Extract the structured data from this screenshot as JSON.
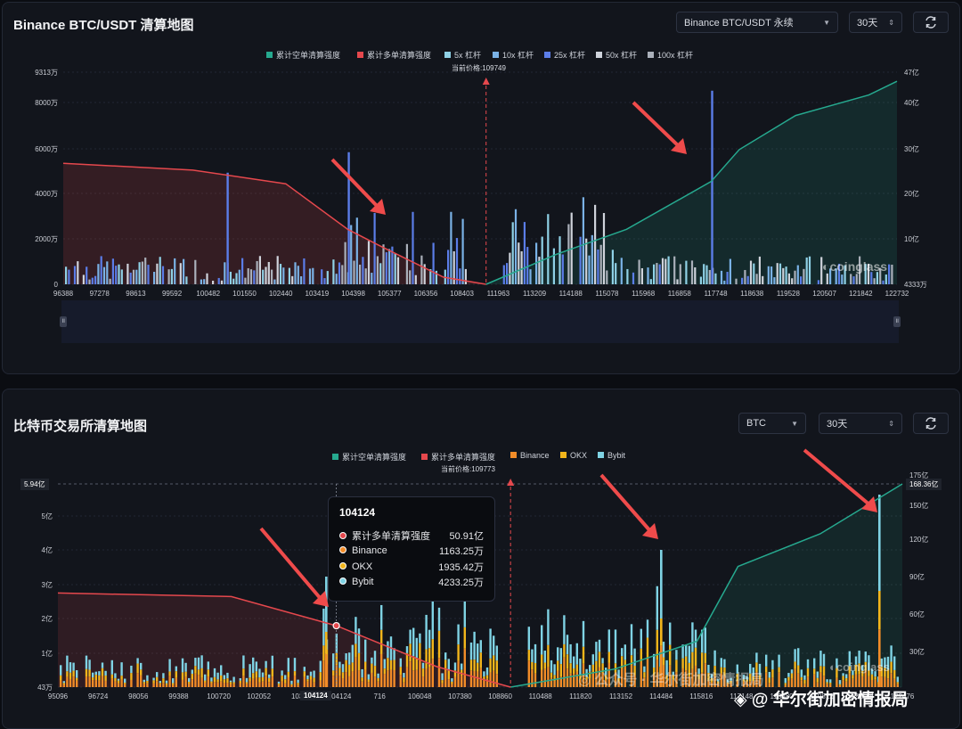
{
  "colors": {
    "short": "#26a98f",
    "long": "#e5484d",
    "lev5": "#8fd1e6",
    "lev10": "#7ab2e6",
    "lev25": "#5b7de8",
    "lev50": "#cfd3db",
    "lev100": "#aab0ba",
    "binance": "#f28c28",
    "okx": "#f2b51b",
    "bybit": "#7fd3e4",
    "accent_arrow": "#ef4b4b"
  },
  "panel1": {
    "title": "Binance BTC/USDT 清算地图",
    "exchange_select": "Binance BTC/USDT 永续",
    "range_select": "30天",
    "refresh_icon": "refresh-icon",
    "legend": [
      "累计空单清算强度",
      "累计多单清算强度",
      "5x 杠杆",
      "10x 杠杆",
      "25x 杠杆",
      "50x 杠杆",
      "100x 杠杆"
    ],
    "price_label": "当前价格:109749",
    "left_ticks": [
      "9313万",
      "8000万",
      "6000万",
      "4000万",
      "2000万",
      "0"
    ],
    "right_ticks": [
      "47亿",
      "40亿",
      "30亿",
      "20亿",
      "10亿",
      "4333万"
    ],
    "x_ticks": [
      "96388",
      "97278",
      "98613",
      "99592",
      "100482",
      "101550",
      "102440",
      "103419",
      "104398",
      "105377",
      "106356",
      "108403",
      "111963",
      "113209",
      "114188",
      "115078",
      "115968",
      "116858",
      "117748",
      "118638",
      "119528",
      "120507",
      "121842",
      "122732"
    ],
    "watermark": "coinglass"
  },
  "panel2": {
    "title": "比特币交易所清算地图",
    "coin_select": "BTC",
    "range_select": "30天",
    "refresh_icon": "refresh-icon",
    "legend": [
      "累计空单清算强度",
      "累计多单清算强度",
      "Binance",
      "OKX",
      "Bybit"
    ],
    "price_label": "当前价格:109773",
    "left_top_badge": "5.94亿",
    "right_top_badge": "168.36亿",
    "left_ticks": [
      "5亿",
      "4亿",
      "3亿",
      "2亿",
      "1亿",
      "43万"
    ],
    "right_ticks": [
      "175亿",
      "150亿",
      "120亿",
      "90亿",
      "60亿",
      "30亿"
    ],
    "x_ticks": [
      "95096",
      "96724",
      "98056",
      "99388",
      "100720",
      "102052",
      "1033",
      "104124",
      "716",
      "106048",
      "107380",
      "108860",
      "110488",
      "111820",
      "113152",
      "114484",
      "115816",
      "117148",
      "118480",
      "119812",
      "121144",
      "122476"
    ],
    "crosshair_label": "104124",
    "tooltip": {
      "title": "104124",
      "rows": [
        {
          "label": "累计多单清算强度",
          "value": "50.91亿",
          "color": "#e5484d"
        },
        {
          "label": "Binance",
          "value": "1163.25万",
          "color": "#f28c28"
        },
        {
          "label": "OKX",
          "value": "1935.42万",
          "color": "#f2b51b"
        },
        {
          "label": "Bybit",
          "value": "4233.25万",
          "color": "#7fd3e4"
        }
      ]
    },
    "watermark": "coinglass",
    "wechat_watermark": "公众号 · 华尔街加密情报局",
    "brand_watermark": "@ 华尔街加密情报局"
  },
  "chart_data": [
    {
      "type": "bar",
      "title": "Binance BTC/USDT 清算地图",
      "current_price": 109749,
      "x_range": [
        96388,
        122732
      ],
      "ylim_left": [
        0,
        93130000
      ],
      "ylim_right": [
        43330000,
        4700000000
      ],
      "series": [
        {
          "name": "累计多单清算强度",
          "type": "line",
          "points": [
            [
              96388,
              2700000000
            ],
            [
              100482,
              2550000000
            ],
            [
              103419,
              2250000000
            ],
            [
              105377,
              1250000000
            ],
            [
              106356,
              900000000
            ],
            [
              108403,
              200000000
            ],
            [
              109749,
              43330000
            ]
          ]
        },
        {
          "name": "累计空单清算强度",
          "type": "line",
          "points": [
            [
              109749,
              43330000
            ],
            [
              111963,
              700000000
            ],
            [
              114188,
              1250000000
            ],
            [
              116858,
              2300000000
            ],
            [
              117748,
              3000000000
            ],
            [
              119528,
              3750000000
            ],
            [
              121842,
              4200000000
            ],
            [
              122732,
              4500000000
            ]
          ]
        }
      ],
      "notable_bars": [
        {
          "x": 101550,
          "value": 49000000
        },
        {
          "x": 105377,
          "value": 58000000
        },
        {
          "x": 116858,
          "value": 85000000
        }
      ]
    },
    {
      "type": "bar",
      "title": "比特币交易所清算地图",
      "current_price": 109773,
      "x_range": [
        95096,
        122476
      ],
      "ylim_left": [
        430000,
        594000000
      ],
      "ylim_right": [
        0,
        16836000000
      ],
      "series": [
        {
          "name": "累计多单清算强度",
          "type": "line",
          "points": [
            [
              95096,
              7800000000
            ],
            [
              100720,
              7500000000
            ],
            [
              104124,
              5091000000
            ],
            [
              107380,
              1700000000
            ],
            [
              109773,
              0
            ]
          ]
        },
        {
          "name": "累计空单清算强度",
          "type": "line",
          "points": [
            [
              109773,
              0
            ],
            [
              113152,
              1500000000
            ],
            [
              115816,
              3800000000
            ],
            [
              117148,
              10000000000
            ],
            [
              119812,
              12700000000
            ],
            [
              122476,
              16836000000
            ]
          ]
        }
      ],
      "stack_order": [
        "Binance",
        "OKX",
        "Bybit"
      ],
      "tooltip_point": {
        "x": 104124,
        "long_cumulative": 5091000000,
        "Binance": 11632500,
        "OKX": 19354200,
        "Bybit": 42332500
      }
    }
  ]
}
